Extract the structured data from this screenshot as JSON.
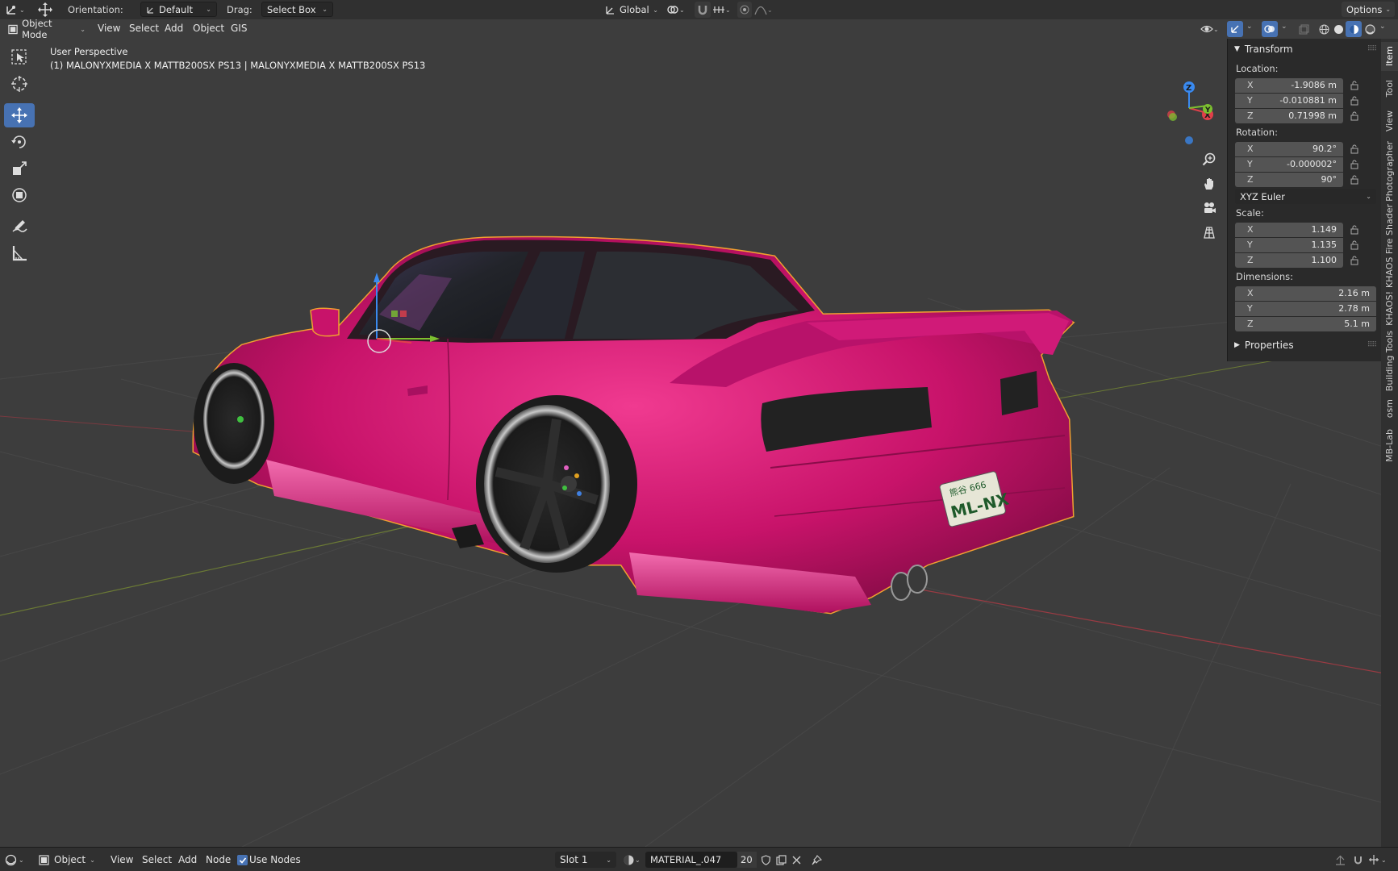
{
  "header": {
    "orientation_label": "Orientation:",
    "orientation_value": "Default",
    "drag_label": "Drag:",
    "drag_value": "Select Box",
    "transform_space": "Global",
    "options_label": "Options"
  },
  "menu": {
    "mode": "Object Mode",
    "items": [
      "View",
      "Select",
      "Add",
      "Object",
      "GIS"
    ]
  },
  "viewport": {
    "perspective": "User Perspective",
    "object_info": "(1) MALONYXMEDIA X MATTB200SX PS13 | MALONYXMEDIA X MATTB200SX PS13",
    "plate_top": "熊谷 666",
    "plate_main": "ML-NX",
    "gizmo": {
      "x": "X",
      "y": "Y",
      "z": "Z"
    }
  },
  "npanel": {
    "transform_title": "Transform",
    "location_label": "Location:",
    "location": [
      {
        "axis": "X",
        "value": "-1.9086 m"
      },
      {
        "axis": "Y",
        "value": "-0.010881 m"
      },
      {
        "axis": "Z",
        "value": "0.71998 m"
      }
    ],
    "rotation_label": "Rotation:",
    "rotation": [
      {
        "axis": "X",
        "value": "90.2°"
      },
      {
        "axis": "Y",
        "value": "-0.000002°"
      },
      {
        "axis": "Z",
        "value": "90°"
      }
    ],
    "rotation_mode": "XYZ Euler",
    "scale_label": "Scale:",
    "scale": [
      {
        "axis": "X",
        "value": "1.149"
      },
      {
        "axis": "Y",
        "value": "1.135"
      },
      {
        "axis": "Z",
        "value": "1.100"
      }
    ],
    "dimensions_label": "Dimensions:",
    "dimensions": [
      {
        "axis": "X",
        "value": "2.16 m"
      },
      {
        "axis": "Y",
        "value": "2.78 m"
      },
      {
        "axis": "Z",
        "value": "5.1 m"
      }
    ],
    "properties_title": "Properties"
  },
  "vtabs": [
    "Item",
    "Tool",
    "View",
    "Photographer",
    "KHAOS Fire Shader",
    "KHAOS!",
    "Building Tools",
    "osm",
    "MB-Lab"
  ],
  "bottom": {
    "editor_mode": "Object",
    "menu": [
      "View",
      "Select",
      "Add",
      "Node"
    ],
    "use_nodes": "Use Nodes",
    "slot": "Slot 1",
    "material": "MATERIAL_.047",
    "users": "20"
  },
  "colors": {
    "accent": "#4772b3",
    "car_body": "#d0186e",
    "selection_outline": "#f0a030",
    "axis_x": "#e0404a",
    "axis_y": "#7cc030",
    "axis_z": "#3a8af0"
  }
}
